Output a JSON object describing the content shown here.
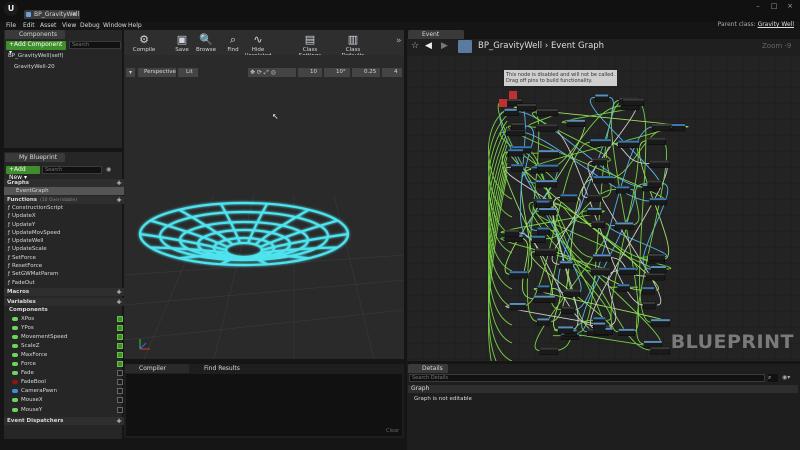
{
  "window": {
    "doc_tab": "BP_GravityWell",
    "parent_label": "Parent class:",
    "parent_value": "Gravity Well"
  },
  "menu": [
    "File",
    "Edit",
    "Asset",
    "View",
    "Debug",
    "Window",
    "Help"
  ],
  "components": {
    "tab": "Components",
    "add_label": "+Add Component ▾",
    "search_placeholder": "Search",
    "root": "BP_GravityWell(self)",
    "child": "GravityWell-20"
  },
  "my_blueprint": {
    "tab": "My Blueprint",
    "add_new": "+Add New ▾",
    "search_placeholder": "Search",
    "graphs_header": "Graphs",
    "event_graph": "EventGraph",
    "functions_header": "Functions",
    "functions_note": "(10 Overridable)",
    "functions": [
      "ConstructionScript",
      "UpdateX",
      "UpdateY",
      "UpdateMovSpeed",
      "UpdateWell",
      "UpdateScale",
      "SetForce",
      "ResetForce",
      "SetGWMatParam",
      "FadeOut"
    ],
    "macros_header": "Macros",
    "variables_header": "Variables",
    "components_header": "Components",
    "variables": [
      {
        "name": "XPos",
        "color": "#6cd65a",
        "checked": true
      },
      {
        "name": "YPos",
        "color": "#6cd65a",
        "checked": true
      },
      {
        "name": "MovementSpeed",
        "color": "#6cd65a",
        "checked": true
      },
      {
        "name": "ScaleZ",
        "color": "#6cd65a",
        "checked": true
      },
      {
        "name": "MaxForce",
        "color": "#6cd65a",
        "checked": true
      },
      {
        "name": "Force",
        "color": "#6cd65a",
        "checked": true
      },
      {
        "name": "Fade",
        "color": "#6cd65a",
        "checked": false
      },
      {
        "name": "FadeBool",
        "color": "#8c1616",
        "checked": false
      },
      {
        "name": "CameraPawn",
        "color": "#3b8fe0",
        "checked": false
      },
      {
        "name": "MouseX",
        "color": "#6cd65a",
        "checked": false
      },
      {
        "name": "MouseY",
        "color": "#6cd65a",
        "checked": false
      }
    ],
    "dispatchers_header": "Event Dispatchers"
  },
  "toolbar": [
    {
      "label": "Compile",
      "icon": "gear-icon",
      "glyph": "⚙"
    },
    {
      "label": "Save",
      "icon": "save-icon",
      "glyph": "▣"
    },
    {
      "label": "Browse",
      "icon": "browse-icon",
      "glyph": "🔍"
    },
    {
      "label": "Find",
      "icon": "find-icon",
      "glyph": "⌕"
    },
    {
      "label": "Hide Unrelated",
      "icon": "hide-unrelated-icon",
      "glyph": "∿"
    },
    {
      "label": "Class Settings",
      "icon": "class-settings-icon",
      "glyph": "▤"
    },
    {
      "label": "Class Defaults",
      "icon": "class-defaults-icon",
      "glyph": "▥"
    }
  ],
  "function_tabs": [
    "V",
    "C",
    "",
    "",
    "Fi",
    "Rr",
    "Fi",
    "U",
    "U",
    "U",
    "Se",
    "Se",
    "U",
    "U"
  ],
  "viewport": {
    "perspective": "Perspective",
    "lit": "Lit",
    "grid_snap": "10",
    "rot_snap": "10°",
    "scale_snap": "0.25",
    "cam_speed": "4"
  },
  "event_graph": {
    "tab": "Event Graph",
    "breadcrumb_root": "BP_GravityWell",
    "breadcrumb_sep": "›",
    "breadcrumb_leaf": "Event Graph",
    "zoom": "Zoom -9",
    "watermark": "BLUEPRINT",
    "comment": "This node is disabled and will not be called. Drag off pins to build functionality."
  },
  "bottom": {
    "compile_tab": "Compiler Results",
    "find_tab": "Find Results",
    "clear": "Clear"
  },
  "details": {
    "tab": "Details",
    "search_placeholder": "Search Details",
    "graph_header": "Graph",
    "graph_text": "Graph is not editable"
  }
}
